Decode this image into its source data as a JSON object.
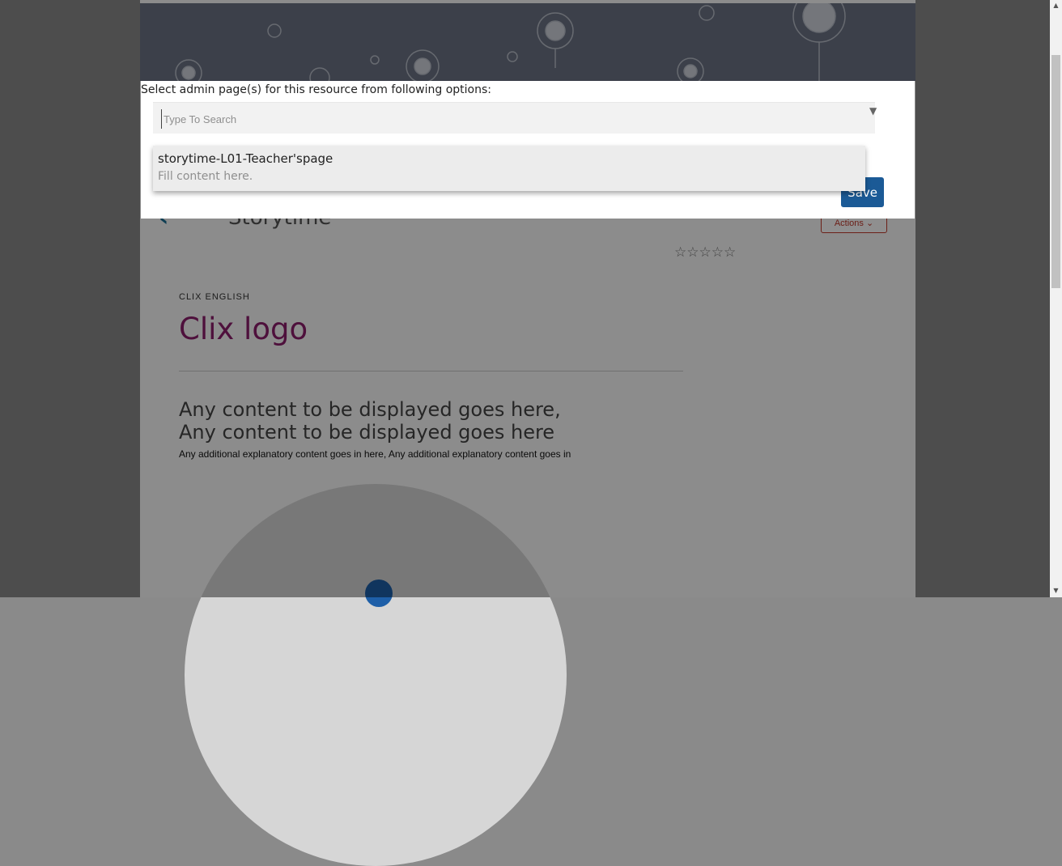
{
  "page": {
    "heading": "Storytime",
    "actions_label": "Actions",
    "rating_stars": "☆☆☆☆☆",
    "overline": "CLIX ENGLISH",
    "title": "Clix logo",
    "body_large": "Any content to be displayed goes here, Any content to be displayed goes here",
    "body_small": "Any additional explanatory content goes in here, Any additional explanatory content goes in"
  },
  "modal": {
    "label": "Select admin page(s) for this resource from following options:",
    "search_placeholder": "Type To Search",
    "caret": "▼",
    "options": [
      {
        "title": "storytime-L01-Teacher'spage",
        "subtitle": "Fill content here."
      }
    ],
    "save_label": "Save"
  },
  "icons": {
    "back": "chevron-left-icon",
    "actions_dropdown": "chevron-down-icon",
    "rating": "star-icon",
    "select_caret": "triangle-down-icon"
  },
  "colors": {
    "accent_blue": "#1b5a96",
    "title_purple": "#8c1d6b",
    "actions_red": "#c0392b",
    "banner": "#6b7385"
  }
}
